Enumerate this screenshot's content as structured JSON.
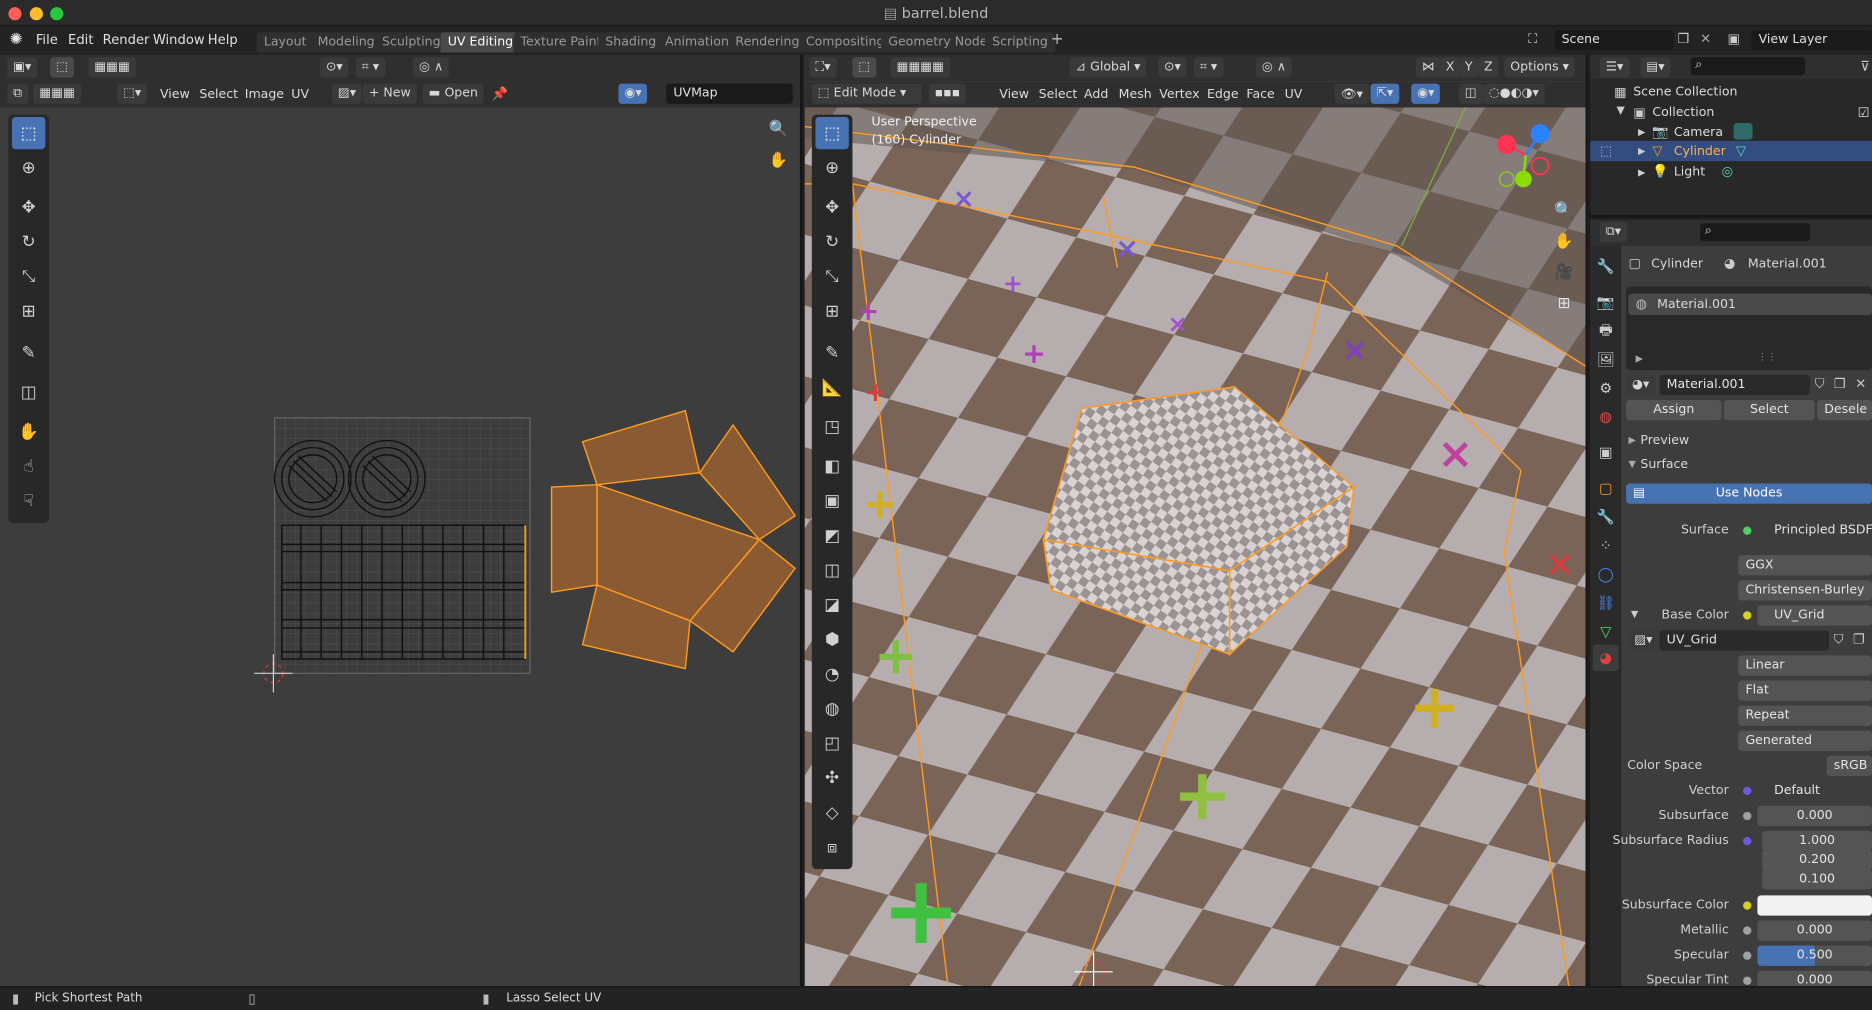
{
  "window": {
    "title": "barrel.blend"
  },
  "menu": {
    "file": "File",
    "edit": "Edit",
    "render": "Render",
    "window": "Window",
    "help": "Help"
  },
  "workspaces": [
    "Layout",
    "Modeling",
    "Sculpting",
    "UV Editing",
    "Texture Paint",
    "Shading",
    "Animation",
    "Rendering",
    "Compositing",
    "Geometry Nodes",
    "Scripting"
  ],
  "active_workspace": "UV Editing",
  "scene": {
    "name": "Scene",
    "view_layer": "View Layer"
  },
  "uv_editor": {
    "menus": {
      "view": "View",
      "select": "Select",
      "image": "Image",
      "uv": "UV"
    },
    "new_label": "New",
    "open_label": "Open",
    "uvmap": "UVMap"
  },
  "viewport": {
    "mode": "Edit Mode",
    "menus": {
      "view": "View",
      "select": "Select",
      "add": "Add",
      "mesh": "Mesh",
      "vertex": "Vertex",
      "edge": "Edge",
      "face": "Face",
      "uv": "UV"
    },
    "transform_orientation": "Global",
    "options_label": "Options",
    "axis": {
      "x": "X",
      "y": "Y",
      "z": "Z"
    },
    "overlay_title": "User Perspective",
    "overlay_object": "(160) Cylinder"
  },
  "outliner": {
    "root": "Scene Collection",
    "collection": "Collection",
    "items": [
      "Camera",
      "Cylinder",
      "Light"
    ]
  },
  "properties": {
    "object": "Cylinder",
    "material": "Material.001",
    "slot": "Material.001",
    "material_field": "Material.001",
    "assign": "Assign",
    "select": "Select",
    "deselect": "Desele",
    "preview": "Preview",
    "surface_panel": "Surface",
    "use_nodes": "Use Nodes",
    "rows": {
      "surface": {
        "label": "Surface",
        "value": "Principled BSDF"
      },
      "distribution": "GGX",
      "subsurface_method": "Christensen-Burley",
      "base_color": {
        "label": "Base Color",
        "value": "UV_Grid"
      },
      "image": "UV_Grid",
      "interpolation": "Linear",
      "projection": "Flat",
      "extension": "Repeat",
      "source": "Generated",
      "color_space": {
        "label": "Color Space",
        "value": "sRGB"
      },
      "vector": {
        "label": "Vector",
        "value": "Default"
      },
      "subsurface": {
        "label": "Subsurface",
        "value": "0.000"
      },
      "subsurface_radius": {
        "label": "Subsurface Radius",
        "values": [
          "1.000",
          "0.200",
          "0.100"
        ]
      },
      "subsurface_color": {
        "label": "Subsurface Color"
      },
      "metallic": {
        "label": "Metallic",
        "value": "0.000"
      },
      "specular": {
        "label": "Specular",
        "value": "0.500",
        "fraction": 0.5
      },
      "specular_tint": {
        "label": "Specular Tint",
        "value": "0.000"
      }
    }
  },
  "status": {
    "left": "Pick Shortest Path",
    "right": "Lasso Select UV"
  },
  "colors": {
    "accent": "#4772b3",
    "uv_fill": "#8a5a32",
    "uv_edge": "#ff9a1f",
    "header": "#2f2f2f"
  }
}
